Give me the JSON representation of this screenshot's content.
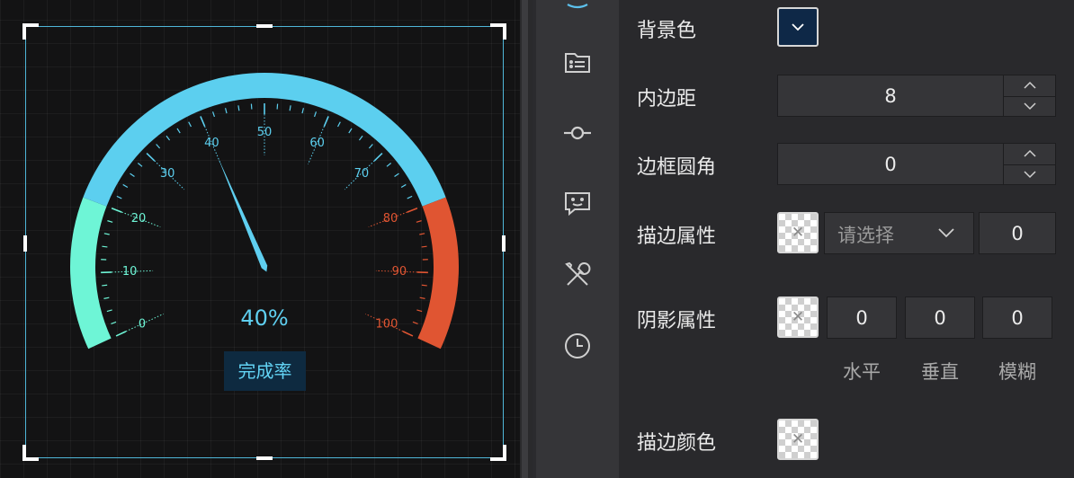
{
  "gauge": {
    "value_text": "40%",
    "label": "完成率",
    "value": 40,
    "min": 0,
    "max": 100,
    "tick_labels": [
      "0",
      "10",
      "20",
      "30",
      "40",
      "50",
      "60",
      "70",
      "80",
      "90",
      "100"
    ],
    "colors": {
      "low_band": "#6ef5d6",
      "mid_band": "#5ccfef",
      "high_band": "#e05532",
      "pointer": "#5fcff0"
    }
  },
  "icon_rail": {
    "items": [
      "layers-icon",
      "list-icon",
      "commit-icon",
      "chat-icon",
      "tools-icon",
      "clock-icon"
    ]
  },
  "panel": {
    "background_color": {
      "label": "背景色",
      "value": "#0e2847"
    },
    "padding": {
      "label": "内边距",
      "value": "8"
    },
    "border_radius": {
      "label": "边框圆角",
      "value": "0"
    },
    "stroke": {
      "label": "描边属性",
      "placeholder": "请选择",
      "width": "0"
    },
    "shadow": {
      "label": "阴影属性",
      "horizontal": "0",
      "vertical": "0",
      "blur": "0",
      "horizontal_label": "水平",
      "vertical_label": "垂直",
      "blur_label": "模糊"
    },
    "stroke_color": {
      "label": "描边颜色"
    }
  }
}
